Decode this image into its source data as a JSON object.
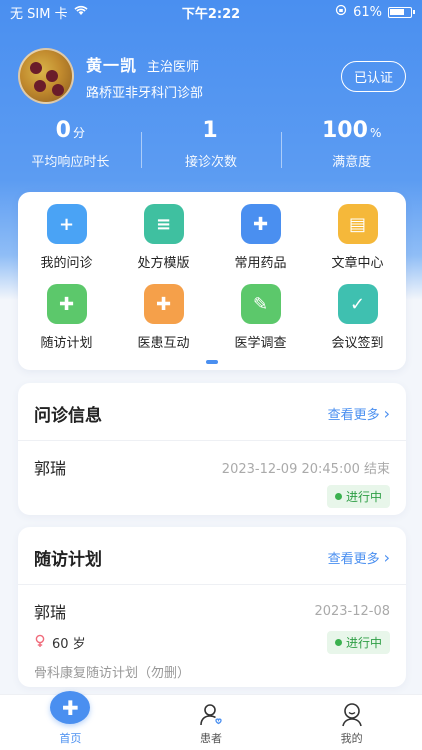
{
  "statusbar": {
    "carrier": "无 SIM 卡",
    "time": "下午2:22",
    "battery": "61%"
  },
  "profile": {
    "name": "黄一凯",
    "title": "主治医师",
    "clinic": "路桥亚非牙科门诊部",
    "verify": "已认证"
  },
  "stats": [
    {
      "value": "0",
      "unit": "分",
      "label": "平均响应时长"
    },
    {
      "value": "1",
      "unit": "",
      "label": "接诊次数"
    },
    {
      "value": "100",
      "unit": "%",
      "label": "满意度"
    }
  ],
  "menu": [
    {
      "label": "我的问诊",
      "icon": "consult-icon",
      "color": "#4aa3f5",
      "glyph": "+"
    },
    {
      "label": "处方模版",
      "icon": "prescription-icon",
      "color": "#3fc0a0",
      "glyph": "≡"
    },
    {
      "label": "常用药品",
      "icon": "medicine-icon",
      "color": "#4a8ff0",
      "glyph": "✚"
    },
    {
      "label": "文章中心",
      "icon": "article-icon",
      "color": "#f5b83a",
      "glyph": "▤"
    },
    {
      "label": "随访计划",
      "icon": "followup-icon",
      "color": "#5cc86b",
      "glyph": "✚"
    },
    {
      "label": "医患互动",
      "icon": "interaction-icon",
      "color": "#f5a04a",
      "glyph": "✚"
    },
    {
      "label": "医学调查",
      "icon": "survey-icon",
      "color": "#5cc86b",
      "glyph": "✎"
    },
    {
      "label": "会议签到",
      "icon": "checkin-icon",
      "color": "#3fc0b0",
      "glyph": "✓"
    }
  ],
  "consult": {
    "title": "问诊信息",
    "more": "查看更多",
    "patient": "郭瑞",
    "time": "2023-12-09 20:45:00 结束",
    "status": "进行中"
  },
  "followup": {
    "title": "随访计划",
    "more": "查看更多",
    "patient": "郭瑞",
    "date": "2023-12-08",
    "age": "60 岁",
    "status": "进行中",
    "plan": "骨科康复随访计划（勿删）"
  },
  "tabs": {
    "home": "首页",
    "patients": "患者",
    "mine": "我的"
  },
  "colors": {
    "primary": "#4a8ff0",
    "success": "#2e9e45"
  }
}
